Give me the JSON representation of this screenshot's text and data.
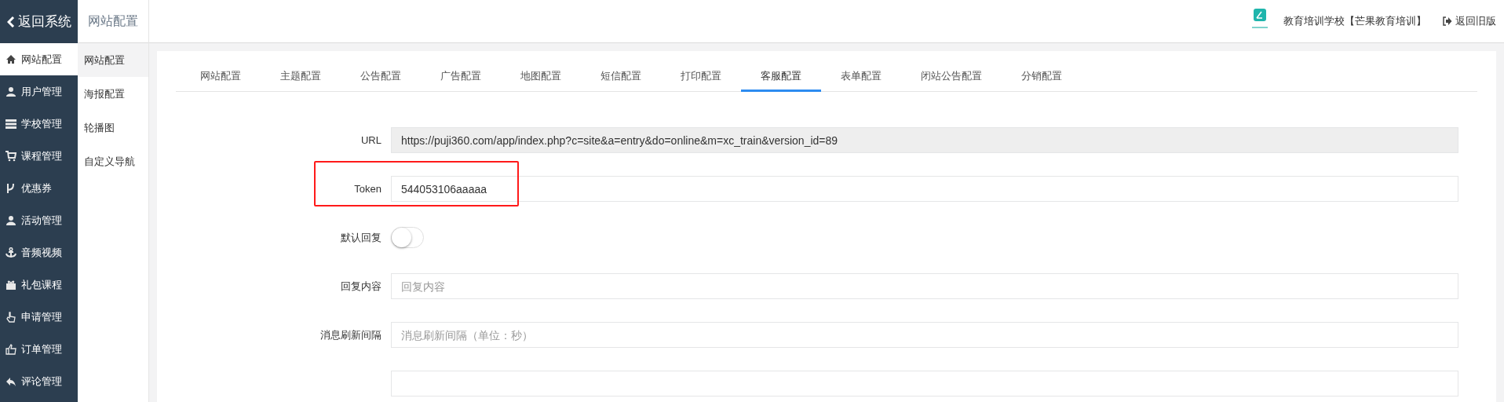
{
  "back_button": {
    "label": "返回系统"
  },
  "section_title": "网站配置",
  "header": {
    "school": "教育培训学校【芒果教育培训】",
    "old_version_link": "返回旧版"
  },
  "sidebar": {
    "items": [
      {
        "label": "网站配置",
        "selected": true
      },
      {
        "label": "用户管理",
        "selected": false
      },
      {
        "label": "学校管理",
        "selected": false
      },
      {
        "label": "课程管理",
        "selected": false
      },
      {
        "label": "优惠券",
        "selected": false
      },
      {
        "label": "活动管理",
        "selected": false
      },
      {
        "label": "音频视频",
        "selected": false
      },
      {
        "label": "礼包课程",
        "selected": false
      },
      {
        "label": "申请管理",
        "selected": false
      },
      {
        "label": "订单管理",
        "selected": false
      },
      {
        "label": "评论管理",
        "selected": false
      }
    ]
  },
  "subnav": {
    "items": [
      {
        "label": "网站配置",
        "selected": true
      },
      {
        "label": "海报配置",
        "selected": false
      },
      {
        "label": "轮播图",
        "selected": false
      },
      {
        "label": "自定义导航",
        "selected": false
      }
    ]
  },
  "tabs": [
    {
      "label": "网站配置",
      "selected": false
    },
    {
      "label": "主题配置",
      "selected": false
    },
    {
      "label": "公告配置",
      "selected": false
    },
    {
      "label": "广告配置",
      "selected": false
    },
    {
      "label": "地图配置",
      "selected": false
    },
    {
      "label": "短信配置",
      "selected": false
    },
    {
      "label": "打印配置",
      "selected": false
    },
    {
      "label": "客服配置",
      "selected": true
    },
    {
      "label": "表单配置",
      "selected": false
    },
    {
      "label": "闭站公告配置",
      "selected": false
    },
    {
      "label": "分销配置",
      "selected": false
    }
  ],
  "form": {
    "rows": [
      {
        "kind": "readonly",
        "label": "URL",
        "value": "https://puji360.com/app/index.php?c=site&a=entry&do=online&m=xc_train&version_id=89",
        "highlighted": false
      },
      {
        "kind": "text",
        "label": "Token",
        "value": "544053106aaaaa",
        "highlighted": true
      },
      {
        "kind": "switch",
        "label": "默认回复",
        "on": false,
        "highlighted": false
      },
      {
        "kind": "text",
        "label": "回复内容",
        "placeholder": "回复内容",
        "highlighted": false
      },
      {
        "kind": "text",
        "label": "消息刷新间隔",
        "placeholder": "消息刷新间隔（单位：秒）",
        "highlighted": false
      },
      {
        "kind": "text",
        "highlighted": false
      }
    ]
  }
}
